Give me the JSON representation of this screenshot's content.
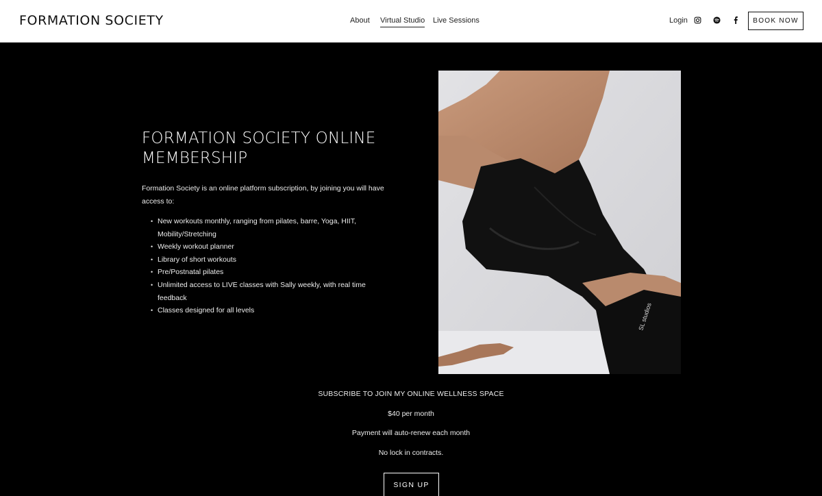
{
  "header": {
    "brand": "FORMATION SOCIETY",
    "nav": [
      {
        "label": "About"
      },
      {
        "label": "Virtual Studio",
        "active": true
      },
      {
        "label": "Live Sessions"
      }
    ],
    "login_label": "Login",
    "social_icons": [
      "instagram-icon",
      "spotify-icon",
      "facebook-icon"
    ],
    "book_button": "BOOK NOW"
  },
  "hero": {
    "title": "FORMATION SOCIETY ONLINE MEMBERSHIP",
    "intro": "Formation Society is an online platform subscription, by joining you will have access to:",
    "features": [
      "New workouts monthly, ranging from pilates, barre, Yoga, HIIT, Mobility/Stretching",
      "Weekly workout planner",
      "Library of short workouts",
      "Pre/Postnatal pilates",
      "Unlimited access to LIVE classes with Sally weekly, with real time feedback",
      "Classes designed for all levels"
    ],
    "photo_brand_text": "SL studios"
  },
  "subscribe": {
    "heading": "SUBSCRIBE TO JOIN MY ONLINE WELLNESS SPACE",
    "price": "$40 per month",
    "renew": "Payment will auto-renew each month",
    "lock": "No lock in contracts.",
    "signup_button": "SIGN UP"
  },
  "colors": {
    "header_bg": "#ffffff",
    "page_bg": "#000000",
    "text_dark": "#111111",
    "text_light": "#ffffff"
  }
}
